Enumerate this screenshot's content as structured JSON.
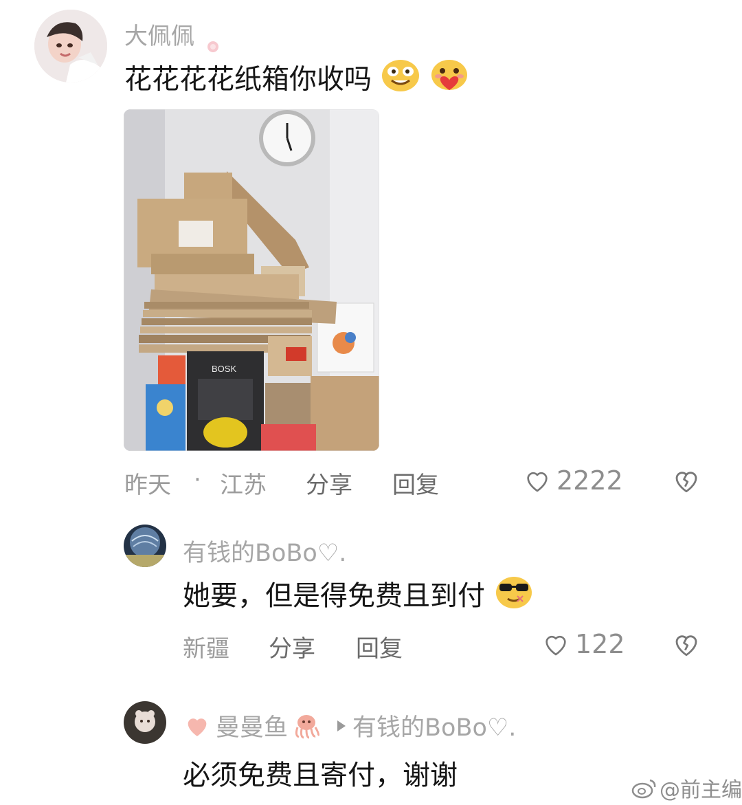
{
  "comments": {
    "main": {
      "username": "大佩佩",
      "text": "花花花花纸箱你收吗",
      "time": "昨天",
      "separator": "·",
      "location": "江苏",
      "share_label": "分享",
      "reply_label": "回复",
      "likes": "2222",
      "photo_texts": [
        "BOSK"
      ]
    },
    "reply1": {
      "username": "有钱的BoBo♡.",
      "text": "她要，但是得免费且到付",
      "location": "新疆",
      "share_label": "分享",
      "reply_label": "回复",
      "likes": "122"
    },
    "reply2": {
      "username": "曼曼鱼",
      "reply_to": "有钱的BoBo♡.",
      "text": "必须免费且寄付，谢谢"
    }
  },
  "watermark": "@前主编",
  "icons": {
    "heart": "heart-outline-icon",
    "broken_heart": "broken-heart-icon",
    "arrow": "reply-arrow-icon",
    "weibo": "weibo-logo-icon"
  }
}
